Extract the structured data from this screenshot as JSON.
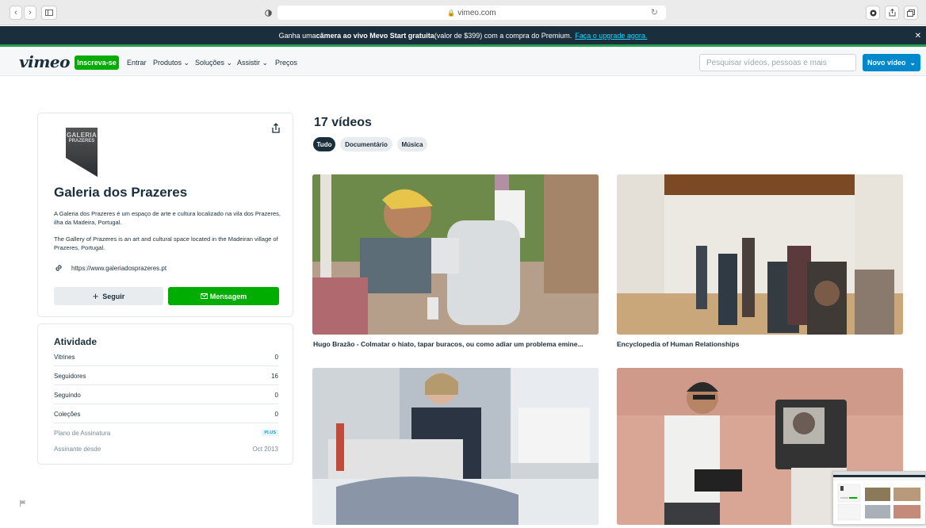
{
  "browser": {
    "url": "vimeo.com"
  },
  "banner": {
    "text_before": "Ganha uma ",
    "bold": "câmera ao vivo Mevo Start gratuita",
    "text_after": " (valor de $399) com a compra do Premium.",
    "link": "Faça o upgrade agora."
  },
  "nav": {
    "logo": "vimeo",
    "join": "Inscreva-se",
    "links": [
      "Entrar",
      "Produtos",
      "Soluções",
      "Assistir",
      "Preços"
    ],
    "search_placeholder": "Pesquisar vídeos, pessoas e mais",
    "new_video": "Novo vídeo"
  },
  "profile": {
    "logo_line1": "GALERIA",
    "logo_line2": "PRAZERES",
    "name": "Galeria dos Prazeres",
    "desc_pt": "A Galeria dos Prazeres é um espaço de arte e cultura localizado na vila dos Prazeres, ilha da Madeira, Portugal.",
    "desc_en": "The Gallery of Prazeres is an art and cultural space located in the Madeiran village of Prazeres, Portugal.",
    "website": "https://www.galeriadosprazeres.pt",
    "follow": "Seguir",
    "message": "Mensagem"
  },
  "activity": {
    "title": "Atividade",
    "rows": [
      {
        "label": "Vitrines",
        "value": "0"
      },
      {
        "label": "Seguidores",
        "value": "16"
      },
      {
        "label": "Seguindo",
        "value": "0"
      },
      {
        "label": "Coleções",
        "value": "0"
      }
    ],
    "plan_label": "Plano de Assinatura",
    "plan_value": "PLUS",
    "since_label": "Assinante desde",
    "since_value": "Oct 2013"
  },
  "videos": {
    "count": "17 vídeos",
    "filters": [
      "Tudo",
      "Documentário",
      "Música"
    ],
    "items": [
      {
        "title": "Hugo Brazão - Colmatar o hiato, tapar buracos, ou como adiar um problema emine..."
      },
      {
        "title": "Encyclopedia of Human Relationships"
      },
      {
        "title": ""
      },
      {
        "title": ""
      }
    ]
  },
  "colors": {
    "brand_green": "#00ad00",
    "brand_blue": "#0088cc",
    "dark": "#1a2e3b"
  }
}
